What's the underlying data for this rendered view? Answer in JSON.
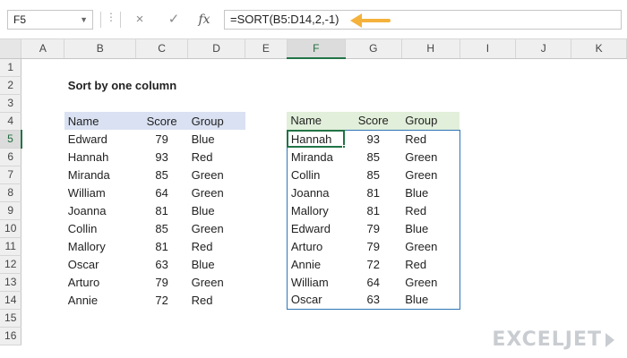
{
  "formula_bar": {
    "name_box": "F5",
    "cancel_icon": "×",
    "enter_icon": "✓",
    "fx_label": "fx",
    "formula": "=SORT(B5:D14,2,-1)"
  },
  "sheet": {
    "columns": [
      "A",
      "B",
      "C",
      "D",
      "E",
      "F",
      "G",
      "H",
      "I",
      "J",
      "K"
    ],
    "rows": [
      "1",
      "2",
      "3",
      "4",
      "5",
      "6",
      "7",
      "8",
      "9",
      "10",
      "11",
      "12",
      "13",
      "14",
      "15",
      "16"
    ],
    "title": "Sort by one column"
  },
  "source_table": {
    "headers": [
      "Name",
      "Score",
      "Group"
    ],
    "rows": [
      [
        "Edward",
        "79",
        "Blue"
      ],
      [
        "Hannah",
        "93",
        "Red"
      ],
      [
        "Miranda",
        "85",
        "Green"
      ],
      [
        "William",
        "64",
        "Green"
      ],
      [
        "Joanna",
        "81",
        "Blue"
      ],
      [
        "Collin",
        "85",
        "Green"
      ],
      [
        "Mallory",
        "81",
        "Red"
      ],
      [
        "Oscar",
        "63",
        "Blue"
      ],
      [
        "Arturo",
        "79",
        "Green"
      ],
      [
        "Annie",
        "72",
        "Red"
      ]
    ]
  },
  "result_table": {
    "headers": [
      "Name",
      "Score",
      "Group"
    ],
    "rows": [
      [
        "Hannah",
        "93",
        "Red"
      ],
      [
        "Miranda",
        "85",
        "Green"
      ],
      [
        "Collin",
        "85",
        "Green"
      ],
      [
        "Joanna",
        "81",
        "Blue"
      ],
      [
        "Mallory",
        "81",
        "Red"
      ],
      [
        "Edward",
        "79",
        "Blue"
      ],
      [
        "Arturo",
        "79",
        "Green"
      ],
      [
        "Annie",
        "72",
        "Red"
      ],
      [
        "William",
        "64",
        "Green"
      ],
      [
        "Oscar",
        "63",
        "Blue"
      ]
    ]
  },
  "watermark": "EXCELJET",
  "colors": {
    "accent_green": "#217346",
    "source_header_bg": "#d9e1f2",
    "result_header_bg": "#e2efda",
    "result_border": "#2e75b6",
    "arrow": "#f4b23c"
  }
}
